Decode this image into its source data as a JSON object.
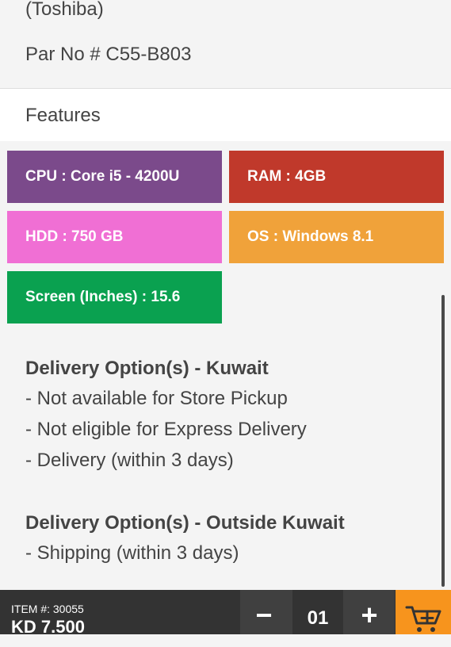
{
  "product": {
    "brand": "(Toshiba)",
    "part_no": "Par No # C55-B803"
  },
  "features": {
    "title": "Features",
    "items": [
      {
        "label": "CPU : Core i5 - 4200U",
        "color": "#7b4a8b"
      },
      {
        "label": "RAM : 4GB",
        "color": "#c0392b"
      },
      {
        "label": "HDD : 750 GB",
        "color": "#f06fd4"
      },
      {
        "label": "OS : Windows 8.1",
        "color": "#f0a23a"
      },
      {
        "label": "Screen (Inches) : 15.6",
        "color": "#0aa150"
      }
    ]
  },
  "delivery_kuwait": {
    "title": "Delivery Option(s) - Kuwait",
    "lines": [
      "- Not available for Store Pickup",
      "- Not eligible for Express Delivery",
      "- Delivery (within 3 days)"
    ]
  },
  "delivery_outside": {
    "title": "Delivery Option(s) - Outside Kuwait",
    "lines": [
      "- Shipping (within 3 days)"
    ]
  },
  "bottom_bar": {
    "item_number": "ITEM #: 30055",
    "price": "KD 7.500",
    "minus_label": "−",
    "quantity": "01",
    "plus_label": "+",
    "cart_icon": "add-to-cart-icon",
    "cart_color": "#f7941d"
  }
}
